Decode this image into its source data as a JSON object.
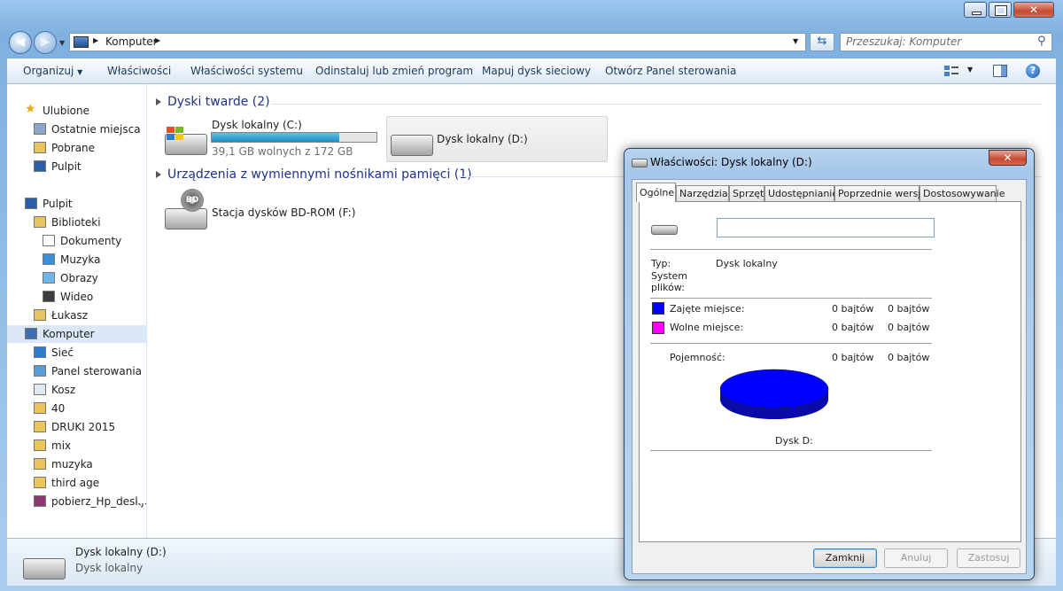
{
  "address": {
    "segment": "Komputer",
    "search_placeholder": "Przeszukaj: Komputer"
  },
  "toolbar": {
    "organize": "Organizuj",
    "properties": "Właściwości",
    "system_properties": "Właściwości systemu",
    "uninstall": "Odinstaluj lub zmień program",
    "map_drive": "Mapuj dysk sieciowy",
    "control_panel": "Otwórz Panel sterowania"
  },
  "sidebar": {
    "items": [
      {
        "label": "Ulubione",
        "icon": "star-icon"
      },
      {
        "label": "Ostatnie miejsca",
        "icon": "recent-places-icon"
      },
      {
        "label": "Pobrane",
        "icon": "downloads-folder-icon"
      },
      {
        "label": "Pulpit",
        "icon": "desktop-icon"
      },
      {
        "label": "Pulpit",
        "icon": "desktop-icon"
      },
      {
        "label": "Biblioteki",
        "icon": "libraries-icon"
      },
      {
        "label": "Dokumenty",
        "icon": "documents-icon"
      },
      {
        "label": "Muzyka",
        "icon": "music-icon"
      },
      {
        "label": "Obrazy",
        "icon": "pictures-icon"
      },
      {
        "label": "Wideo",
        "icon": "video-icon"
      },
      {
        "label": "Łukasz",
        "icon": "user-folder-icon"
      },
      {
        "label": "Komputer",
        "icon": "computer-icon"
      },
      {
        "label": "Sieć",
        "icon": "network-icon"
      },
      {
        "label": "Panel sterowania",
        "icon": "control-panel-icon"
      },
      {
        "label": "Kosz",
        "icon": "recycle-bin-icon"
      },
      {
        "label": "40",
        "icon": "folder-icon"
      },
      {
        "label": "DRUKI 2015",
        "icon": "folder-icon"
      },
      {
        "label": "mix",
        "icon": "folder-icon"
      },
      {
        "label": "muzyka",
        "icon": "folder-icon"
      },
      {
        "label": "third age",
        "icon": "folder-icon"
      },
      {
        "label": "pobierz_Hp_deskjet_",
        "icon": "archive-icon"
      }
    ]
  },
  "content": {
    "hard_drives_header": "Dyski twarde (2)",
    "drive_c": {
      "name": "Dysk lokalny (C:)",
      "free": "39,1 GB wolnych z 172 GB",
      "used_fraction": 0.773
    },
    "drive_d": {
      "name": "Dysk lokalny (D:)"
    },
    "removable_header": "Urządzenia z wymiennymi nośnikami pamięci (1)",
    "bd_drive": {
      "name": "Stacja dysków BD-ROM (F:)",
      "badge": "BD"
    }
  },
  "details": {
    "name": "Dysk lokalny (D:)",
    "type": "Dysk lokalny"
  },
  "dialog": {
    "title": "Właściwości: Dysk lokalny (D:)",
    "close_glyph": "✕",
    "tabs": [
      "Ogólne",
      "Narzędzia",
      "Sprzęt",
      "Udostępnianie",
      "Poprzednie wersje",
      "Dostosowywanie"
    ],
    "name_value": "",
    "type_label": "Typ:",
    "type_value": "Dysk lokalny",
    "fs_label_1": "System",
    "fs_label_2": "plików:",
    "used_label": "Zajęte miejsce:",
    "used_bytes": "0 bajtów",
    "used_size": "0 bajtów",
    "free_label": "Wolne miejsce:",
    "free_bytes": "0 bajtów",
    "free_size": "0 bajtów",
    "capacity_label": "Pojemność:",
    "capacity_bytes": "0 bajtów",
    "capacity_size": "0 bajtów",
    "disk_label": "Dysk D:",
    "used_color": "#0000ff",
    "free_color": "#ff00ff",
    "buttons": {
      "close": "Zamknij",
      "cancel": "Anuluj",
      "apply": "Zastosuj"
    }
  }
}
